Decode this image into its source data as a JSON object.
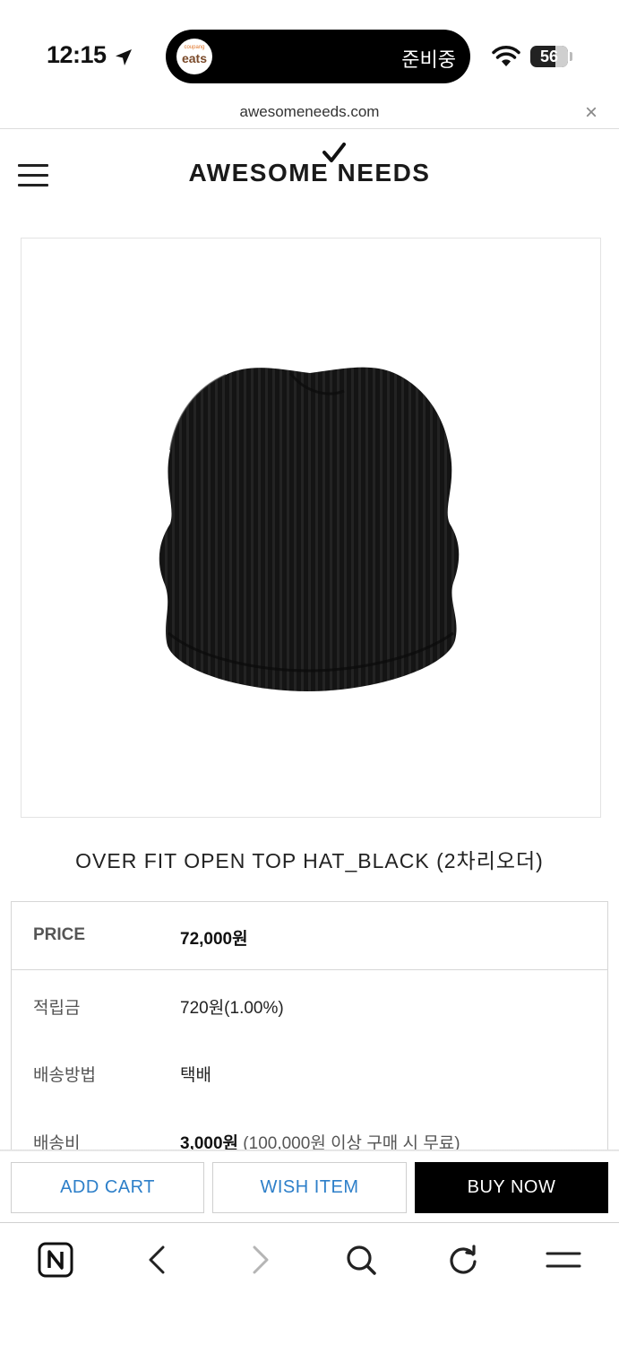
{
  "status_bar": {
    "time": "12:15",
    "island_app": {
      "small": "coupang",
      "large": "eats"
    },
    "island_text": "준비중",
    "battery": "56"
  },
  "browser": {
    "url": "awesomeneeds.com",
    "close_label": "×"
  },
  "header": {
    "logo_text": "AWESOME NEEDS"
  },
  "product": {
    "title": "OVER FIT OPEN TOP HAT_BLACK (2차리오더)",
    "image_icon": "black-knit-beanie-image"
  },
  "info": {
    "price_label": "PRICE",
    "price_value": "72,000원",
    "points_label": "적립금",
    "points_value": "720원(1.00%)",
    "shipping_label": "배송방법",
    "shipping_value": "택배",
    "fee_label": "배송비",
    "fee_value": "3,000원",
    "fee_note": " (100,000원 이상 구매 시 무료)"
  },
  "actions": {
    "add_cart": "ADD CART",
    "wish_item": "WISH ITEM",
    "buy_now": "BUY NOW"
  },
  "nav_icons": [
    "naver-n-icon",
    "back-icon",
    "forward-icon",
    "search-icon",
    "refresh-icon",
    "menu-icon"
  ],
  "colors": {
    "link_blue": "#2d7fc9",
    "buy_bg": "#000000"
  }
}
